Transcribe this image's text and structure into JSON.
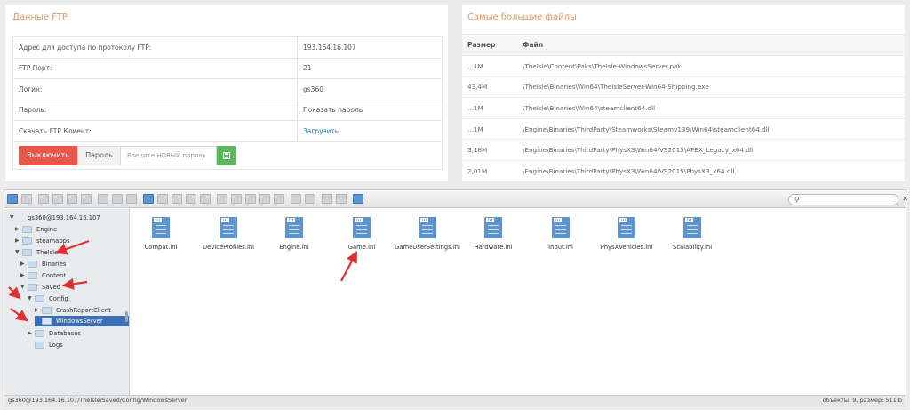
{
  "ftp": {
    "title": "Данные FTP",
    "rows": [
      {
        "label": "Адрес для доступа по протоколу FTP:",
        "value": "193.164.16.107"
      },
      {
        "label": "FTP Порт:",
        "value": "21"
      },
      {
        "label": "Логин:",
        "value": "gs360"
      },
      {
        "label": "Пароль:",
        "value": "Показать пароль"
      },
      {
        "label": "Скачать FTP Клиент:",
        "value": "Загрузить"
      }
    ],
    "disable_button": "Выключить",
    "password_button": "Пароль",
    "new_password_placeholder": "Введите НОВЫЙ пароль"
  },
  "files": {
    "title": "Самые большие файлы",
    "headers": [
      "Размер",
      "Файл"
    ],
    "rows": [
      {
        "size": "...1M",
        "path": "\\TheIsle\\Content\\Paks\\TheIsle-WindowsServer.pak"
      },
      {
        "size": "43,4M",
        "path": "\\TheIsle\\Binaries\\Win64\\TheIsleServer-Win64-Shipping.exe"
      },
      {
        "size": "...1M",
        "path": "\\TheIsle\\Binaries\\Win64\\steamclient64.dll"
      },
      {
        "size": "...1M",
        "path": "\\Engine\\Binaries\\ThirdParty\\Steamworks\\Steamv139\\Win64\\steamclient64.dll"
      },
      {
        "size": "3,18M",
        "path": "\\Engine\\Binaries\\ThirdParty\\PhysX3\\Win64\\VS2015\\APEX_Legacy_x64.dll"
      },
      {
        "size": "2,01M",
        "path": "\\Engine\\Binaries\\ThirdParty\\PhysX3\\Win64\\VS2015\\PhysX3_x64.dll"
      }
    ]
  },
  "filemanager": {
    "tree": {
      "root": "gs360@193.164.16.107",
      "engine": "Engine",
      "steamapps": "steamapps",
      "theisle": "TheIsle",
      "binaries": "Binaries",
      "content": "Content",
      "saved": "Saved",
      "config": "Config",
      "crashreport": "CrashReportClient",
      "windowsserver": "WindowsServer",
      "databases": "Databases",
      "logs": "Logs"
    },
    "file_type_tag": "txt",
    "files": [
      "Compat.ini",
      "DeviceProfiles.ini",
      "Engine.ini",
      "Game.ini",
      "GameUserSettings.ini",
      "Hardware.ini",
      "Input.ini",
      "PhysXVehicles.ini",
      "Scalability.ini"
    ],
    "status_path": "gs360@193.164.16.107/TheIsle/Saved/Config/WindowsServer",
    "status_info": "объекты: 9, размер: 511 b",
    "search_icon": "search-icon",
    "clear_icon": "close-icon",
    "accent_color": "#3c6eb4",
    "arrow_color": "#e03030"
  }
}
